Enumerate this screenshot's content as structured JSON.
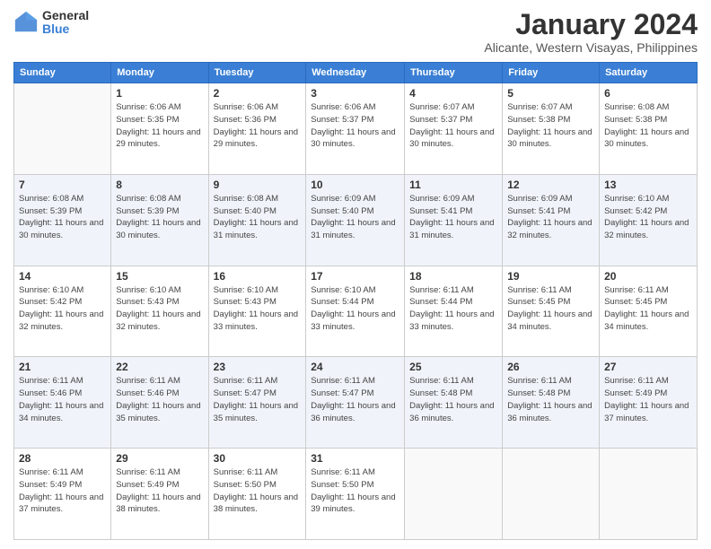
{
  "logo": {
    "general": "General",
    "blue": "Blue"
  },
  "title": "January 2024",
  "subtitle": "Alicante, Western Visayas, Philippines",
  "headers": [
    "Sunday",
    "Monday",
    "Tuesday",
    "Wednesday",
    "Thursday",
    "Friday",
    "Saturday"
  ],
  "weeks": [
    [
      {
        "num": "",
        "sunrise": "",
        "sunset": "",
        "daylight": ""
      },
      {
        "num": "1",
        "sunrise": "Sunrise: 6:06 AM",
        "sunset": "Sunset: 5:35 PM",
        "daylight": "Daylight: 11 hours and 29 minutes."
      },
      {
        "num": "2",
        "sunrise": "Sunrise: 6:06 AM",
        "sunset": "Sunset: 5:36 PM",
        "daylight": "Daylight: 11 hours and 29 minutes."
      },
      {
        "num": "3",
        "sunrise": "Sunrise: 6:06 AM",
        "sunset": "Sunset: 5:37 PM",
        "daylight": "Daylight: 11 hours and 30 minutes."
      },
      {
        "num": "4",
        "sunrise": "Sunrise: 6:07 AM",
        "sunset": "Sunset: 5:37 PM",
        "daylight": "Daylight: 11 hours and 30 minutes."
      },
      {
        "num": "5",
        "sunrise": "Sunrise: 6:07 AM",
        "sunset": "Sunset: 5:38 PM",
        "daylight": "Daylight: 11 hours and 30 minutes."
      },
      {
        "num": "6",
        "sunrise": "Sunrise: 6:08 AM",
        "sunset": "Sunset: 5:38 PM",
        "daylight": "Daylight: 11 hours and 30 minutes."
      }
    ],
    [
      {
        "num": "7",
        "sunrise": "Sunrise: 6:08 AM",
        "sunset": "Sunset: 5:39 PM",
        "daylight": "Daylight: 11 hours and 30 minutes."
      },
      {
        "num": "8",
        "sunrise": "Sunrise: 6:08 AM",
        "sunset": "Sunset: 5:39 PM",
        "daylight": "Daylight: 11 hours and 30 minutes."
      },
      {
        "num": "9",
        "sunrise": "Sunrise: 6:08 AM",
        "sunset": "Sunset: 5:40 PM",
        "daylight": "Daylight: 11 hours and 31 minutes."
      },
      {
        "num": "10",
        "sunrise": "Sunrise: 6:09 AM",
        "sunset": "Sunset: 5:40 PM",
        "daylight": "Daylight: 11 hours and 31 minutes."
      },
      {
        "num": "11",
        "sunrise": "Sunrise: 6:09 AM",
        "sunset": "Sunset: 5:41 PM",
        "daylight": "Daylight: 11 hours and 31 minutes."
      },
      {
        "num": "12",
        "sunrise": "Sunrise: 6:09 AM",
        "sunset": "Sunset: 5:41 PM",
        "daylight": "Daylight: 11 hours and 32 minutes."
      },
      {
        "num": "13",
        "sunrise": "Sunrise: 6:10 AM",
        "sunset": "Sunset: 5:42 PM",
        "daylight": "Daylight: 11 hours and 32 minutes."
      }
    ],
    [
      {
        "num": "14",
        "sunrise": "Sunrise: 6:10 AM",
        "sunset": "Sunset: 5:42 PM",
        "daylight": "Daylight: 11 hours and 32 minutes."
      },
      {
        "num": "15",
        "sunrise": "Sunrise: 6:10 AM",
        "sunset": "Sunset: 5:43 PM",
        "daylight": "Daylight: 11 hours and 32 minutes."
      },
      {
        "num": "16",
        "sunrise": "Sunrise: 6:10 AM",
        "sunset": "Sunset: 5:43 PM",
        "daylight": "Daylight: 11 hours and 33 minutes."
      },
      {
        "num": "17",
        "sunrise": "Sunrise: 6:10 AM",
        "sunset": "Sunset: 5:44 PM",
        "daylight": "Daylight: 11 hours and 33 minutes."
      },
      {
        "num": "18",
        "sunrise": "Sunrise: 6:11 AM",
        "sunset": "Sunset: 5:44 PM",
        "daylight": "Daylight: 11 hours and 33 minutes."
      },
      {
        "num": "19",
        "sunrise": "Sunrise: 6:11 AM",
        "sunset": "Sunset: 5:45 PM",
        "daylight": "Daylight: 11 hours and 34 minutes."
      },
      {
        "num": "20",
        "sunrise": "Sunrise: 6:11 AM",
        "sunset": "Sunset: 5:45 PM",
        "daylight": "Daylight: 11 hours and 34 minutes."
      }
    ],
    [
      {
        "num": "21",
        "sunrise": "Sunrise: 6:11 AM",
        "sunset": "Sunset: 5:46 PM",
        "daylight": "Daylight: 11 hours and 34 minutes."
      },
      {
        "num": "22",
        "sunrise": "Sunrise: 6:11 AM",
        "sunset": "Sunset: 5:46 PM",
        "daylight": "Daylight: 11 hours and 35 minutes."
      },
      {
        "num": "23",
        "sunrise": "Sunrise: 6:11 AM",
        "sunset": "Sunset: 5:47 PM",
        "daylight": "Daylight: 11 hours and 35 minutes."
      },
      {
        "num": "24",
        "sunrise": "Sunrise: 6:11 AM",
        "sunset": "Sunset: 5:47 PM",
        "daylight": "Daylight: 11 hours and 36 minutes."
      },
      {
        "num": "25",
        "sunrise": "Sunrise: 6:11 AM",
        "sunset": "Sunset: 5:48 PM",
        "daylight": "Daylight: 11 hours and 36 minutes."
      },
      {
        "num": "26",
        "sunrise": "Sunrise: 6:11 AM",
        "sunset": "Sunset: 5:48 PM",
        "daylight": "Daylight: 11 hours and 36 minutes."
      },
      {
        "num": "27",
        "sunrise": "Sunrise: 6:11 AM",
        "sunset": "Sunset: 5:49 PM",
        "daylight": "Daylight: 11 hours and 37 minutes."
      }
    ],
    [
      {
        "num": "28",
        "sunrise": "Sunrise: 6:11 AM",
        "sunset": "Sunset: 5:49 PM",
        "daylight": "Daylight: 11 hours and 37 minutes."
      },
      {
        "num": "29",
        "sunrise": "Sunrise: 6:11 AM",
        "sunset": "Sunset: 5:49 PM",
        "daylight": "Daylight: 11 hours and 38 minutes."
      },
      {
        "num": "30",
        "sunrise": "Sunrise: 6:11 AM",
        "sunset": "Sunset: 5:50 PM",
        "daylight": "Daylight: 11 hours and 38 minutes."
      },
      {
        "num": "31",
        "sunrise": "Sunrise: 6:11 AM",
        "sunset": "Sunset: 5:50 PM",
        "daylight": "Daylight: 11 hours and 39 minutes."
      },
      {
        "num": "",
        "sunrise": "",
        "sunset": "",
        "daylight": ""
      },
      {
        "num": "",
        "sunrise": "",
        "sunset": "",
        "daylight": ""
      },
      {
        "num": "",
        "sunrise": "",
        "sunset": "",
        "daylight": ""
      }
    ]
  ]
}
